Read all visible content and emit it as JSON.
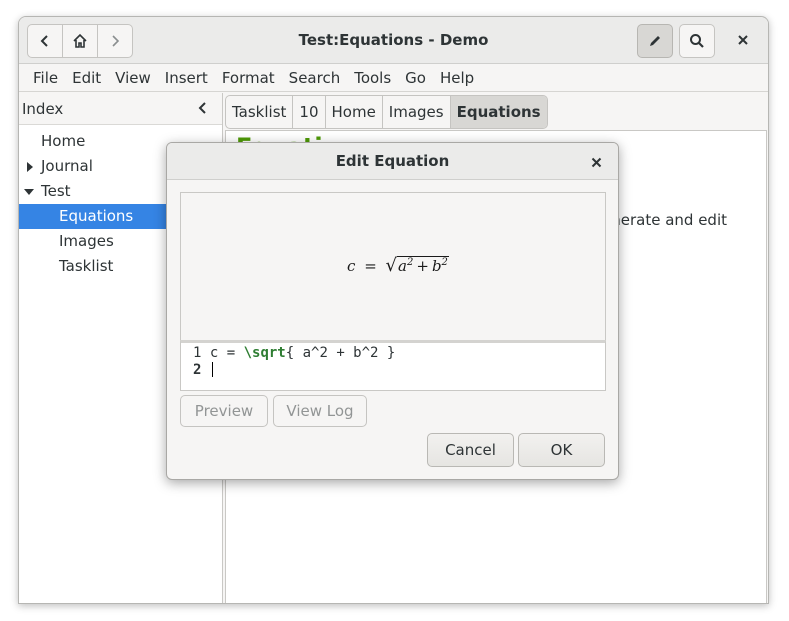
{
  "window": {
    "title": "Test:Equations - Demo"
  },
  "menubar": {
    "items": [
      "File",
      "Edit",
      "View",
      "Insert",
      "Format",
      "Search",
      "Tools",
      "Go",
      "Help"
    ]
  },
  "sidebar": {
    "title": "Index",
    "items": [
      {
        "label": "Home",
        "level": 0,
        "expander": "none",
        "selected": false
      },
      {
        "label": "Journal",
        "level": 0,
        "expander": "collapsed",
        "selected": false
      },
      {
        "label": "Test",
        "level": 0,
        "expander": "expanded",
        "selected": false
      },
      {
        "label": "Equations",
        "level": 1,
        "expander": "none",
        "selected": true
      },
      {
        "label": "Images",
        "level": 1,
        "expander": "none",
        "selected": false
      },
      {
        "label": "Tasklist",
        "level": 1,
        "expander": "none",
        "selected": false
      }
    ]
  },
  "pathbar": {
    "items": [
      "Tasklist",
      "10",
      "Home",
      "Images",
      "Equations"
    ],
    "active_index": 4
  },
  "page": {
    "heading": "Equati",
    "text": "enerate and edit"
  },
  "dialog": {
    "title": "Edit Equation",
    "preview": {
      "lhs": "c",
      "eq": "=",
      "radicand_a": "a",
      "radicand_b": "b",
      "exp": "2",
      "plus": "+"
    },
    "editor": {
      "lines": [
        {
          "num": "1",
          "pre": "c = ",
          "cmd": "\\sqrt",
          "post": "{ a^2 + b^2 }"
        },
        {
          "num": "2",
          "pre": "",
          "cmd": "",
          "post": ""
        }
      ]
    },
    "buttons": {
      "preview": "Preview",
      "view_log": "View Log",
      "cancel": "Cancel",
      "ok": "OK"
    }
  },
  "colors": {
    "accent": "#3584e4",
    "heading": "#4e9a06",
    "latex_command": "#2e7d32"
  }
}
